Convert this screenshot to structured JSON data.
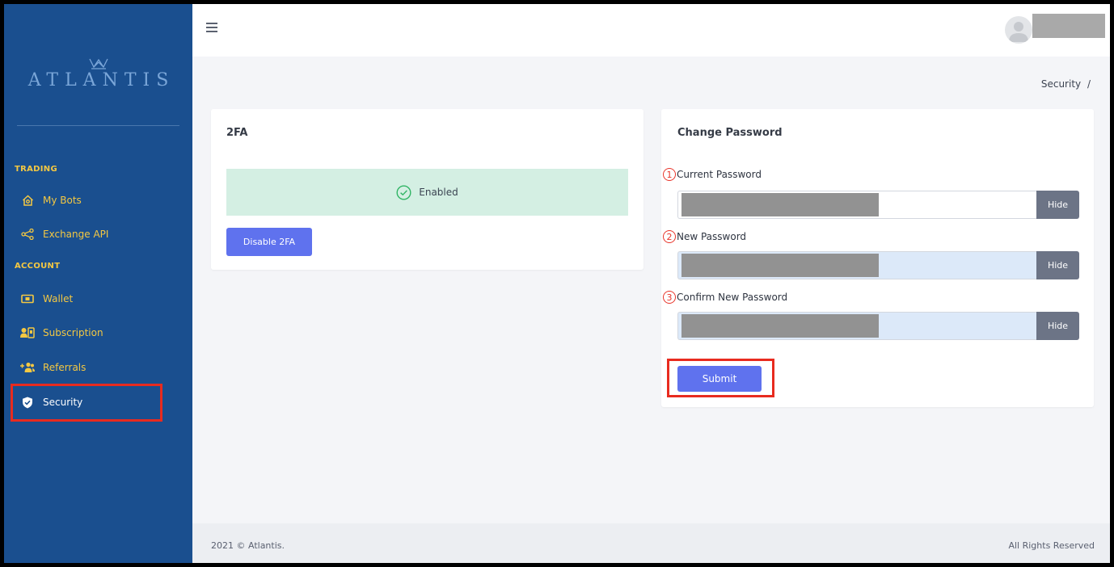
{
  "brand": {
    "name": "ATLANTIS"
  },
  "colors": {
    "sidebar_bg": "#1a4f8f",
    "nav_text": "#f4c842",
    "primary": "#5f72ee",
    "success_bg": "#d4efe3",
    "highlight": "#e82b1f"
  },
  "sidebar": {
    "sections": [
      {
        "heading": "TRADING",
        "items": [
          {
            "label": "My Bots",
            "icon": "home-bot-icon"
          },
          {
            "label": "Exchange API",
            "icon": "share-nodes-icon"
          }
        ]
      },
      {
        "heading": "ACCOUNT",
        "items": [
          {
            "label": "Wallet",
            "icon": "money-bill-icon"
          },
          {
            "label": "Subscription",
            "icon": "user-card-icon"
          },
          {
            "label": "Referrals",
            "icon": "users-plus-icon"
          },
          {
            "label": "Security",
            "icon": "shield-check-icon",
            "active": true
          }
        ]
      }
    ]
  },
  "topbar": {
    "menu_icon": "hamburger-icon",
    "avatar_icon": "user-avatar-icon"
  },
  "breadcrumb": {
    "current": "Security",
    "separator": "/"
  },
  "twofa": {
    "title": "2FA",
    "status": "Enabled",
    "disable_label": "Disable 2FA"
  },
  "change_password": {
    "title": "Change Password",
    "fields": [
      {
        "index": "1",
        "label": "Current Password",
        "toggle": "Hide"
      },
      {
        "index": "2",
        "label": "New Password",
        "toggle": "Hide"
      },
      {
        "index": "3",
        "label": "Confirm New Password",
        "toggle": "Hide"
      }
    ],
    "submit_label": "Submit"
  },
  "footer": {
    "copyright": "2021 © Atlantis.",
    "rights": "All Rights Reserved"
  }
}
